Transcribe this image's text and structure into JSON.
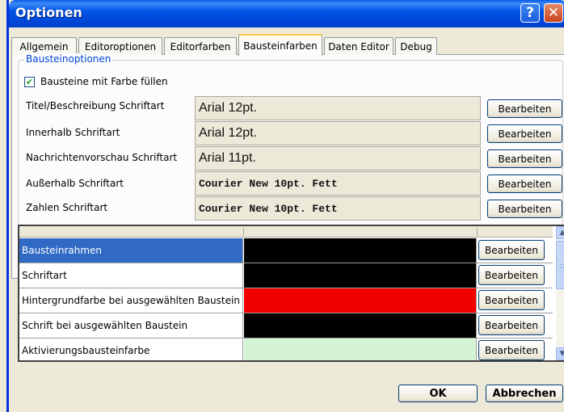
{
  "window": {
    "title": "Optionen"
  },
  "titlebar": {
    "help_glyph": "?",
    "close_glyph": "✕"
  },
  "tabs": [
    {
      "label": "Allgemein"
    },
    {
      "label": "Editoroptionen"
    },
    {
      "label": "Editorfarben"
    },
    {
      "label": "Bausteinfarben"
    },
    {
      "label": "Daten Editor"
    },
    {
      "label": "Debug"
    }
  ],
  "group": {
    "legend": "Bausteinoptionen"
  },
  "fill_checkbox": {
    "label": "Bausteine mit Farbe füllen",
    "checked": true,
    "glyph": "✔"
  },
  "font_rows": [
    {
      "label": "Titel/Beschreibung Schriftart",
      "preview": "Arial 12pt.",
      "button": "Bearbeiten"
    },
    {
      "label": "Innerhalb Schriftart",
      "preview": "Arial 12pt.",
      "button": "Bearbeiten"
    },
    {
      "label": "Nachrichtenvorschau Schriftart",
      "preview": "Arial 11pt.",
      "button": "Bearbeiten"
    },
    {
      "label": "Außerhalb Schriftart",
      "preview": "Courier New 10pt. Fett",
      "button": "Bearbeiten"
    },
    {
      "label": "Zahlen Schriftart",
      "preview": "Courier New 10pt. Fett",
      "button": "Bearbeiten"
    }
  ],
  "color_rows": [
    {
      "name": "Bausteinrahmen",
      "color": "#000000",
      "button": "Bearbeiten",
      "selected": true
    },
    {
      "name": "Schriftart",
      "color": "#000000",
      "button": "Bearbeiten",
      "selected": false
    },
    {
      "name": "Hintergrundfarbe bei ausgewählten Baustein",
      "color": "#f20000",
      "button": "Bearbeiten",
      "selected": false
    },
    {
      "name": "Schrift bei ausgewählten Baustein",
      "color": "#000000",
      "button": "Bearbeiten",
      "selected": false
    },
    {
      "name": "Aktivierungsbausteinfarbe",
      "color": "#d5f3d5",
      "button": "Bearbeiten",
      "selected": false
    },
    {
      "name": "",
      "color": "#f7d9a8",
      "button": "",
      "selected": false
    }
  ],
  "scrollbar": {
    "up_glyph": "▲",
    "down_glyph": "▼"
  },
  "footer": {
    "ok": "OK",
    "cancel": "Abbrechen"
  },
  "colors": {
    "titlebar": "#0055e5",
    "selection": "#316ac5",
    "active_tab_accent": "#ffc73c"
  }
}
